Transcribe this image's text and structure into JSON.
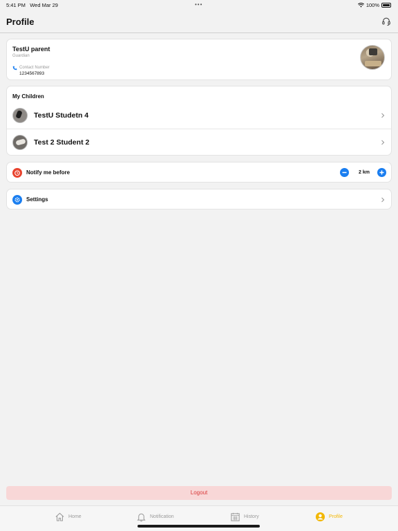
{
  "status_bar": {
    "time": "5:41 PM",
    "date": "Wed Mar 29",
    "battery": "100%",
    "dots": "•••"
  },
  "header": {
    "title": "Profile"
  },
  "profile": {
    "name": "TestU parent",
    "role": "Guardian",
    "contact_label": "Contact Number",
    "contact_value": "1234567893"
  },
  "children": {
    "title": "My Children",
    "items": [
      {
        "name": "TestU Studetn 4"
      },
      {
        "name": "Test 2 Student 2"
      }
    ]
  },
  "notify": {
    "label": "Notify me before",
    "value": "2 km",
    "icon_color": "#e8432e"
  },
  "settings": {
    "label": "Settings",
    "icon_color": "#1a7ef0"
  },
  "logout": {
    "label": "Logout"
  },
  "tabs": [
    {
      "label": "Home",
      "icon": "home-icon"
    },
    {
      "label": "Notification",
      "icon": "bell-icon"
    },
    {
      "label": "History",
      "icon": "calendar-icon"
    },
    {
      "label": "Profile",
      "icon": "user-icon",
      "active": true
    }
  ],
  "colors": {
    "accent": "#1a7ef0",
    "active_tab": "#f2b705",
    "logout_bg": "#f8d7d7",
    "logout_text": "#d93a3a"
  }
}
